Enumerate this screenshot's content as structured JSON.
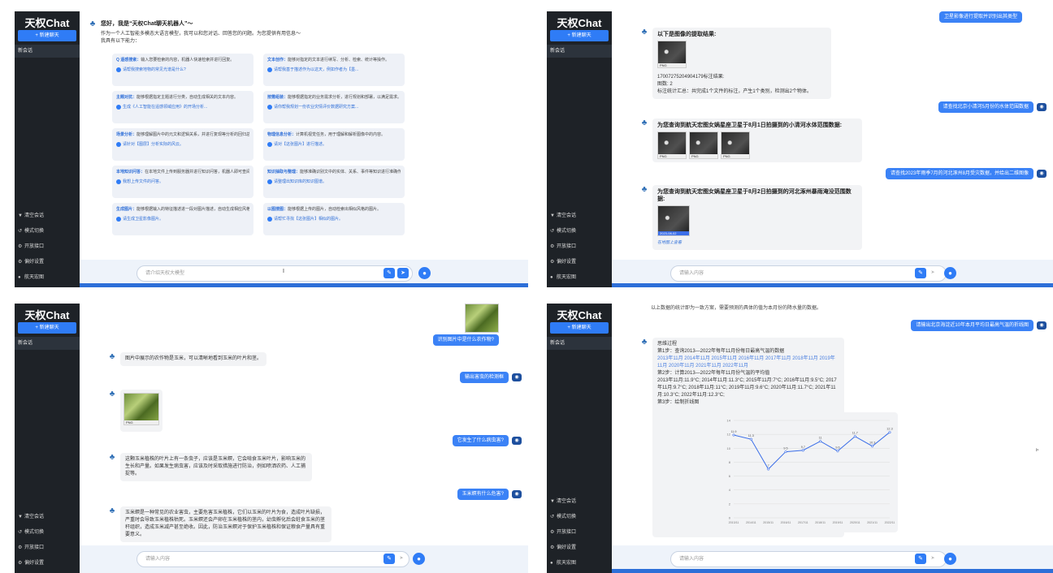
{
  "sidebar": {
    "logo": "天权Chat",
    "new_chat": "+ 新建聊天",
    "session": "新会话",
    "menu": [
      {
        "icon": "trash-icon",
        "glyph": "▼",
        "label": "清空会话"
      },
      {
        "icon": "switch-icon",
        "glyph": "↺",
        "label": "模式切换"
      },
      {
        "icon": "api-icon",
        "glyph": "⚙",
        "label": "开放接口"
      },
      {
        "icon": "settings-icon",
        "glyph": "⚙",
        "label": "偏好设置"
      },
      {
        "icon": "user-icon",
        "glyph": "●",
        "label": "航天宏图"
      }
    ]
  },
  "panel1": {
    "greeting": "您好，我是“天权Chat聊天机器人”～",
    "intro1": "作为一个人工智能多模态大语言模型，我可以和您对话、回答您的问题。为您提供有用信息～",
    "intro2": "我具有以下能力：",
    "cards": [
      {
        "title": "Q 遥感搜索：",
        "text": "输入您要检索的内容，机器人快速检索并进行回复。",
        "link": "请帮我搜索地物的常见光谱是什么?"
      },
      {
        "title": "文本创作：",
        "text": "能够对指定的文本进行续写、分析、检索、统计等操作。",
        "link": "请帮我基于描述作为以这天，例如作者为【墨..."
      },
      {
        "title": "主题对抗：",
        "text": "能够根据指定主题进行分类，自动生成相关的文本内容。",
        "link": "生成《人工智能在遥感领域应用》的开场分析..."
      },
      {
        "title": "按需组装：",
        "text": "能够根据指定的业务需求分析，进行规划和部署，以满足需求。",
        "link": "请你帮我规划一份农业灾情评价数据研究方案..."
      },
      {
        "title": "场景分析：",
        "text": "能够理解图片中的元文和逻辑关系，并进行复现等分析的回归总结论。",
        "link": "请针对【图层】分析实际的风云。"
      },
      {
        "title": "物理信息分析：",
        "text": "计算机视觉任务，用于理解和解析图像中的内容。",
        "link": "请对【这张图片】进行描述。"
      },
      {
        "title": "本地知识问答：",
        "text": "在本地文件上传到服务器并进行知识问答，机器人即可查阅文档中的知识进行准确作答。",
        "link": "我想上传文件的问答。"
      },
      {
        "title": "知识抽取与整理：",
        "text": "能够准确识别文中的实体、关系、事件等知识进行准确作答以及生成的结构化数据。",
        "link": "请整理出知识库的知识图谱。"
      },
      {
        "title": "生成图片：",
        "text": "能够根据输入的特征描述进一段对图片描述，自动生成相应风格图片的内容。",
        "link": "请生成卫星影像图片。"
      },
      {
        "title": "以图搜图：",
        "text": "能够根据上传的图片，自动检索出相似风格的图片。",
        "link": "请帮忙寻找【这张图片】相似的图片。"
      }
    ],
    "input_text": "请介绍天权大模型"
  },
  "panel2": {
    "top_user": "卫星影像进行提取并识别出其类型",
    "extract_title": "以下是图像的提取结果:",
    "extract_file": "17007275204904179标注结果:",
    "extract_count": "图数: 2",
    "extract_summary": "标注统计汇总：共完成1个文件的标注，产生1个类别，检测出2个物体。",
    "user2": "请查找北京小清河5月份的水体范围数据",
    "bot2": "为您查询到航天宏图女娲星座卫星于8月1日拍摄到的小清河水体范围数据:",
    "user3": "请查找2023年雨季7月的河北涿州8月受灾数据，并给出二维图像",
    "bot3": "为您查询到航天宏图女娲星座卫星于8月2日拍摄到的河北涿州暴雨淹没范围数据:",
    "thumb_caption": "在地图上查看",
    "input_placeholder": "请输入内容"
  },
  "panel3": {
    "top_user": "识别图片中是什么农作物?",
    "bot1": "图片中展示的农作物是玉米，可以清晰地看到玉米的叶片和茎。",
    "user2": "输出害虫的检测框",
    "user3": "它发生了什么病虫害?",
    "bot3": "这颗玉米植株的叶片上有一条虫子，应该是玉米螟，它会啃食玉米叶片，影响玉米的生长和产量。如果发生病虫害，应该及时采取措施进行防治，例如喷洒农药、人工捕捉等。",
    "user4": "玉米螟有什么危害?",
    "bot4": "玉米螟是一种常见的农业害虫，主要危害玉米植株，它们以玉米的叶片为食，造成叶片缺损，严重时会导致玉米植株枯死。玉米螟还会产卵在玉米植株的茎内，幼虫孵化后会蛀食玉米的茎秆组织，造成玉米减产甚至绝收。因此，防治玉米螟对于保护玉米植株和保证粮食产量具有重要意义。",
    "input_placeholder": "请输入内容"
  },
  "panel4": {
    "top_text": "以上数据的统计即为一致方案，需要预测的具体的值为本月份的降水量的数据。",
    "user1": "请输出北京海淀近10年本月平均日最高气温的折线图",
    "bot_title": "思维过程",
    "step1": "第1步：查询2013—2022年每年11月份每日最高气温的数据",
    "step1_links": "2013年11月 2014年11月 2015年11月 2016年11月 2017年11月 2018年11月 2019年11月 2020年11月 2021年11月 2022年11月",
    "step2": "第2步：计算2013—2022年每年11月份气温的平均值",
    "step2_values": "2013年11月:11.9°C; 2014年11月:11.3°C; 2015年11月:7°C; 2016年11月:9.5°C; 2017年11月:9.7°C; 2018年11月:11°C; 2019年11月:9.6°C; 2020年11月:11.7°C; 2021年11月:10.3°C; 2022年11月:12.3°C;",
    "step3": "第3步：绘制折线图",
    "input_placeholder": "请输入内容"
  },
  "chart_data": {
    "type": "line",
    "categories": [
      "2013/11",
      "2014/11",
      "2015/11",
      "2016/11",
      "2017/11",
      "2018/11",
      "2019/11",
      "2020/11",
      "2021/11",
      "2022/11"
    ],
    "values": [
      11.9,
      11.3,
      7,
      9.5,
      9.7,
      11,
      9.6,
      11.7,
      10.3,
      12.3
    ],
    "ylim": [
      0,
      14
    ],
    "yticks": [
      0,
      2,
      4,
      6,
      8,
      10,
      12,
      14
    ],
    "color": "#3b6ee8"
  },
  "colors": {
    "accent": "#2f7cf6",
    "sidebar": "#1e2227",
    "user_bubble": "#3b82f6"
  }
}
